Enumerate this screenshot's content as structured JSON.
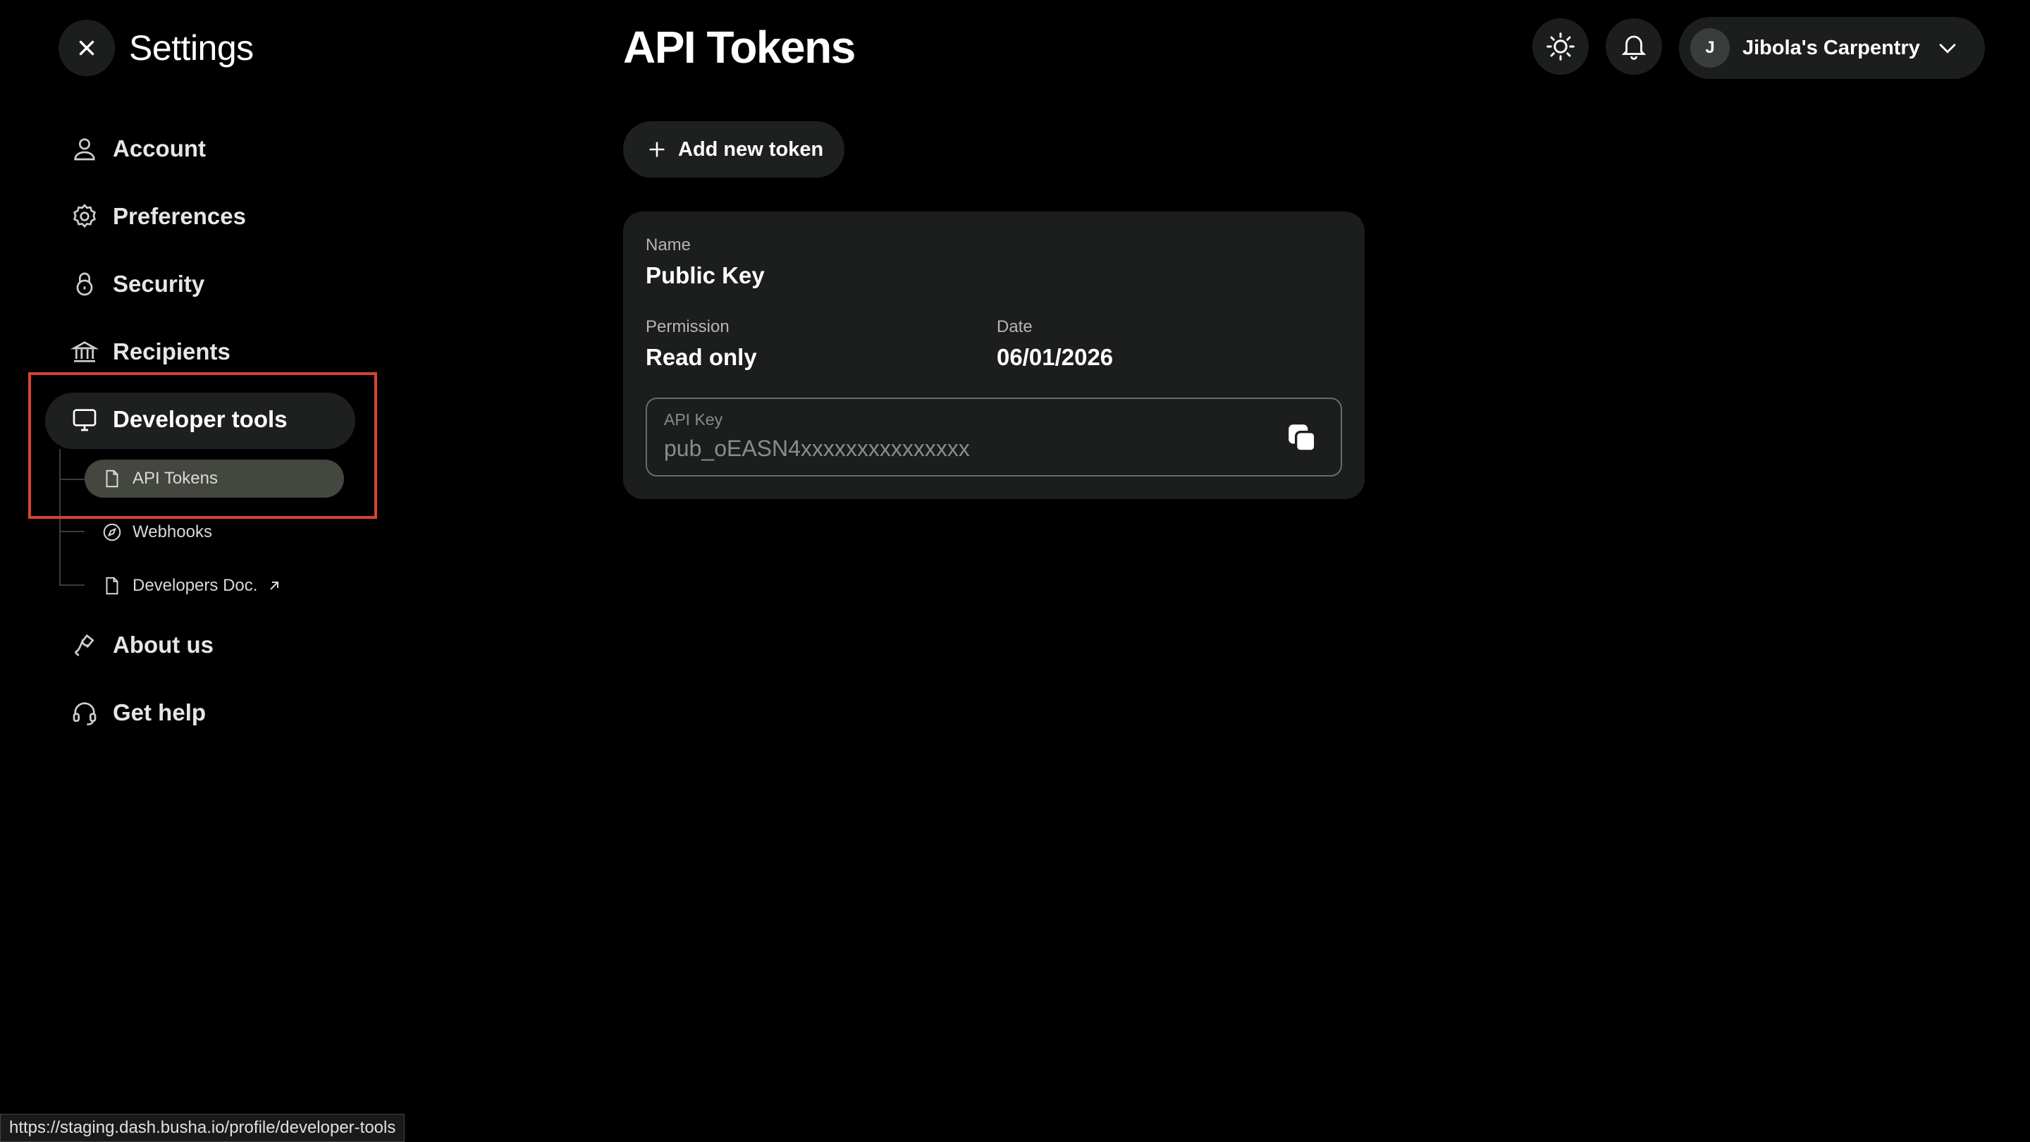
{
  "settings": {
    "title": "Settings"
  },
  "sidebar": {
    "items": [
      {
        "label": "Account",
        "icon": "user-icon"
      },
      {
        "label": "Preferences",
        "icon": "gear-icon"
      },
      {
        "label": "Security",
        "icon": "lock-icon"
      },
      {
        "label": "Recipients",
        "icon": "bank-icon"
      },
      {
        "label": "Developer tools",
        "icon": "monitor-icon"
      },
      {
        "label": "About us",
        "icon": "about-icon"
      },
      {
        "label": "Get help",
        "icon": "headset-icon"
      }
    ],
    "developer_subitems": [
      {
        "label": "API Tokens",
        "icon": "document-icon",
        "active": true
      },
      {
        "label": "Webhooks",
        "icon": "compass-icon"
      },
      {
        "label": "Developers Doc.",
        "icon": "document-icon",
        "external": true
      }
    ]
  },
  "page": {
    "title": "API Tokens",
    "add_button_label": "Add new token"
  },
  "token": {
    "name_label": "Name",
    "name_value": "Public Key",
    "permission_label": "Permission",
    "permission_value": "Read only",
    "date_label": "Date",
    "date_value": "06/01/2026",
    "api_key_label": "API Key",
    "api_key_value": "pub_oEASN4xxxxxxxxxxxxxxx"
  },
  "header": {
    "account_initial": "J",
    "account_name": "Jibola's Carpentry"
  },
  "status_bar": {
    "url": "https://staging.dash.busha.io/profile/developer-tools"
  },
  "colors": {
    "background": "#000000",
    "surface": "#1c1e1d",
    "active_sub": "#44473f",
    "highlight": "#d9432e"
  }
}
